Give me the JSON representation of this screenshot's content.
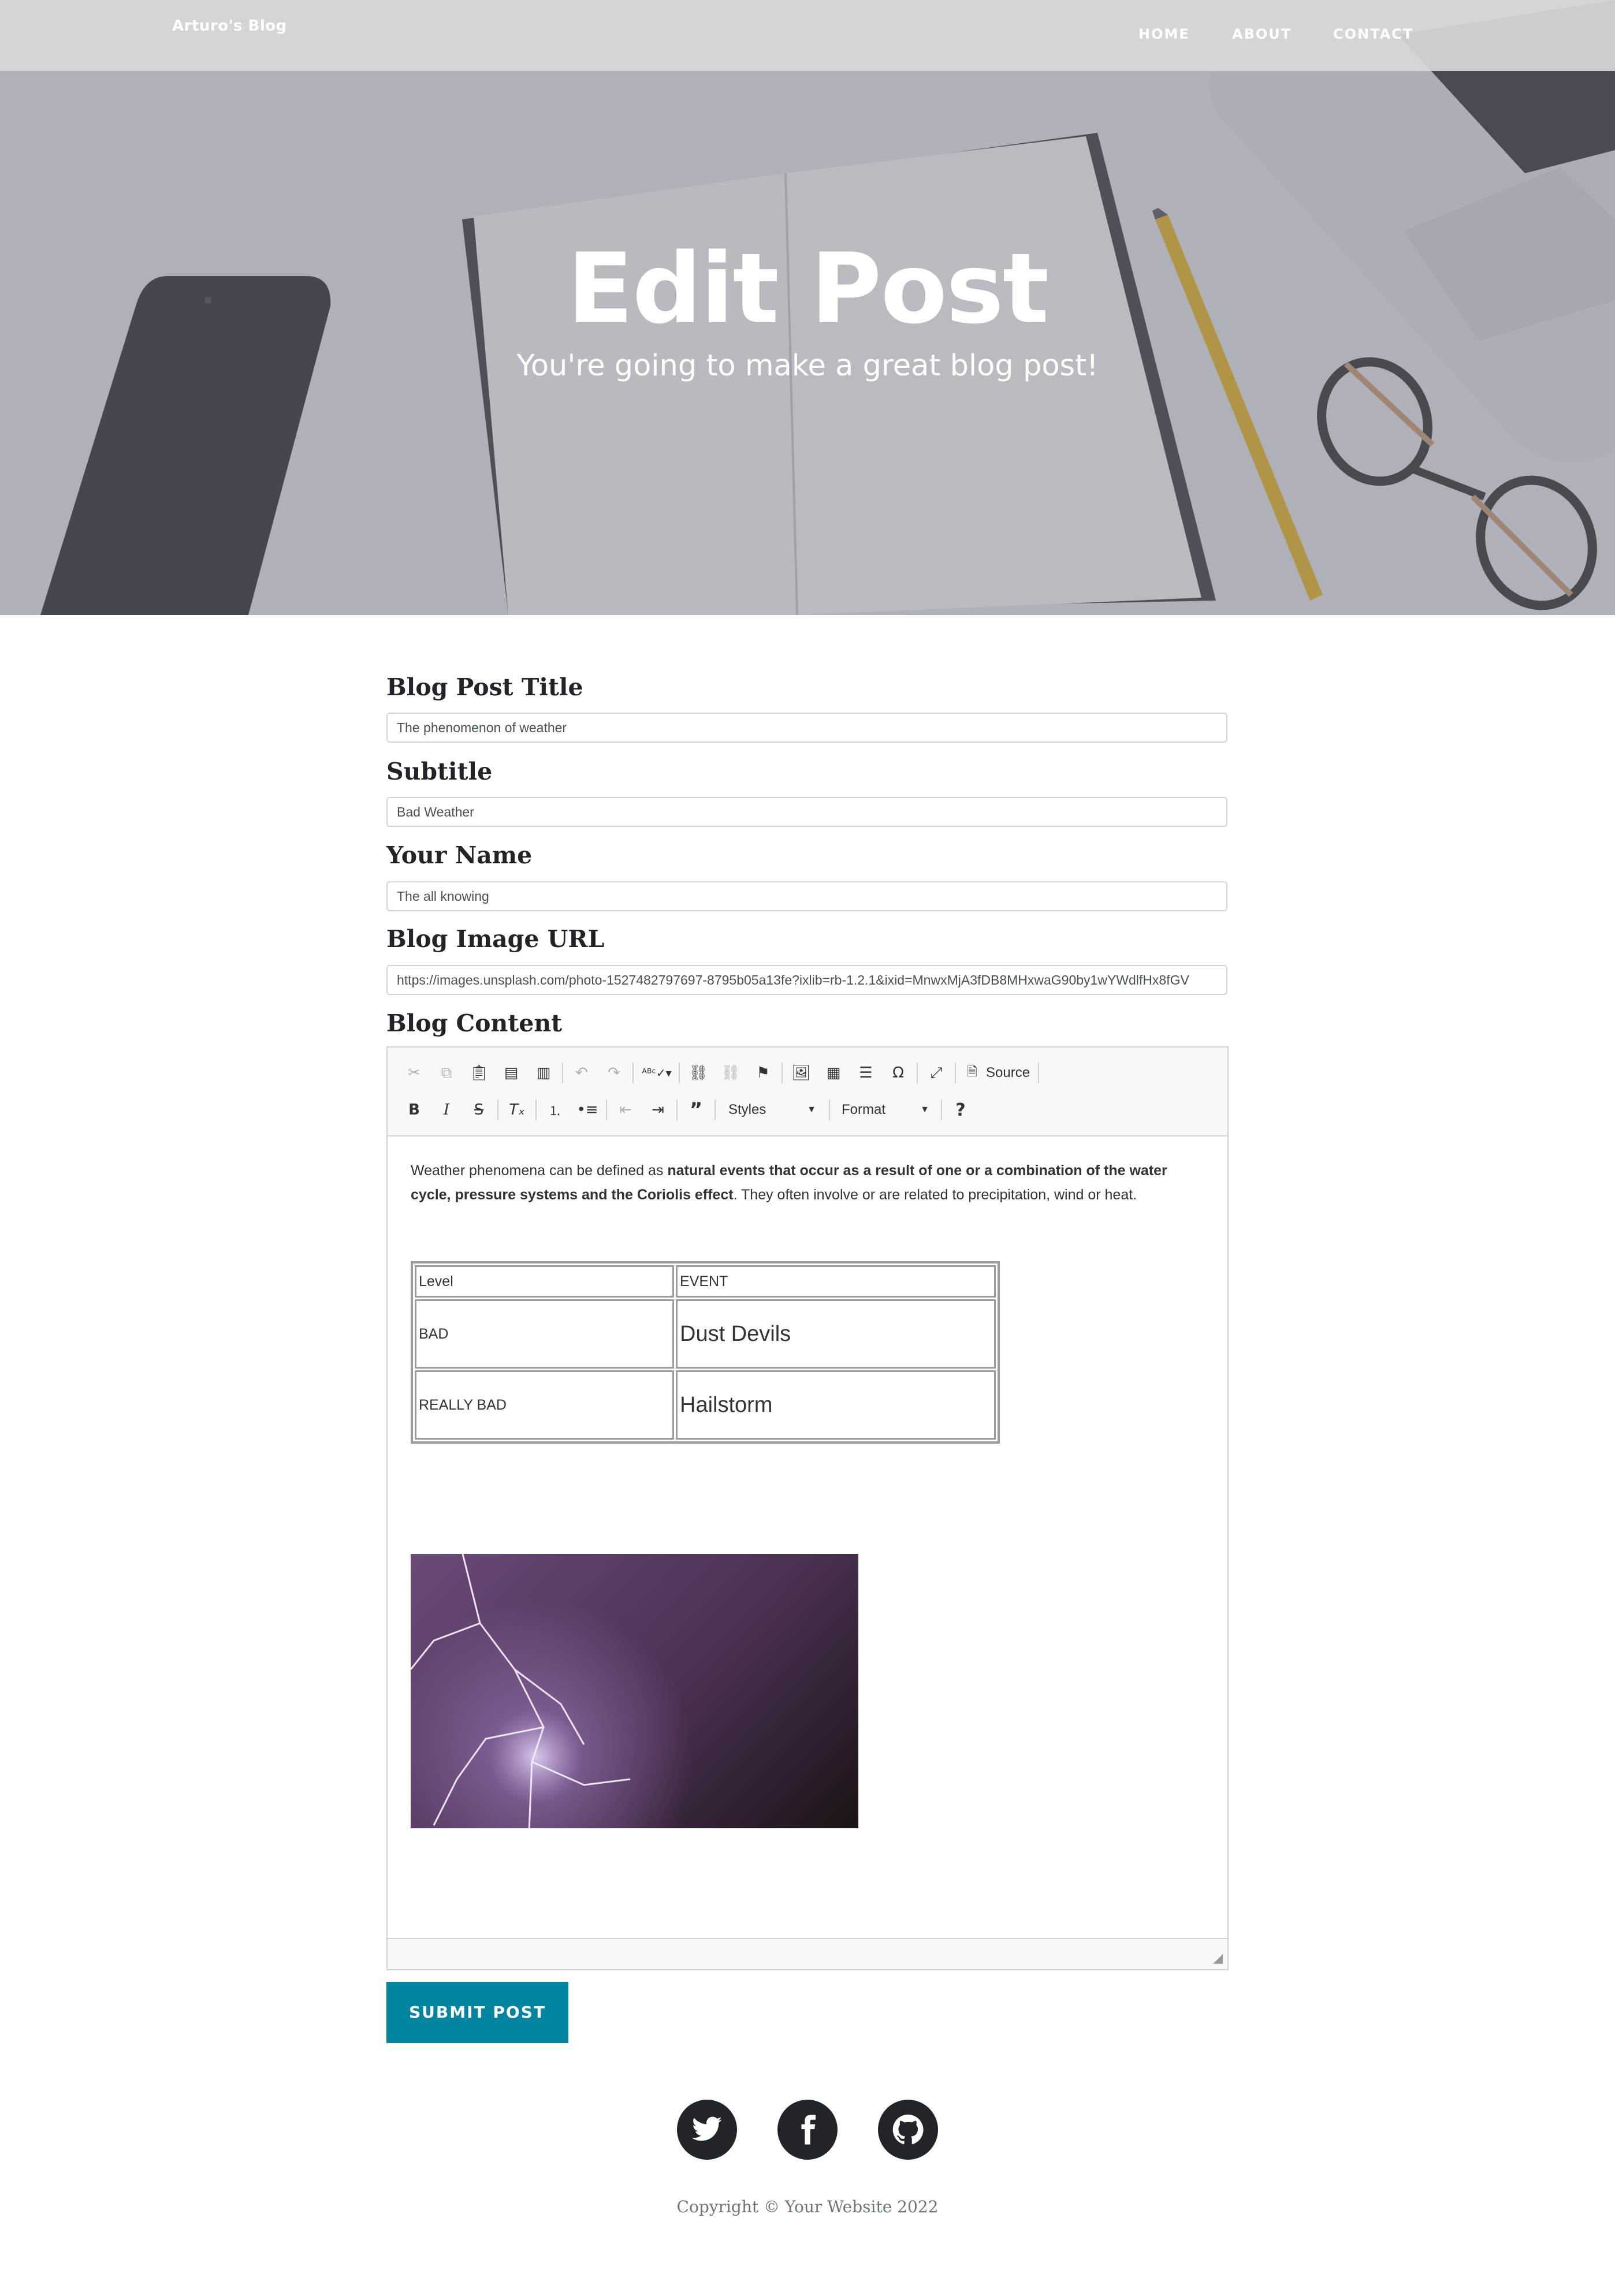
{
  "nav": {
    "brand": "Arturo's Blog",
    "links": [
      "HOME",
      "ABOUT",
      "CONTACT"
    ]
  },
  "masthead": {
    "title": "Edit Post",
    "subtitle": "You're going to make a great blog post!"
  },
  "form": {
    "title_label": "Blog Post Title",
    "title_value": "The phenomenon of weather",
    "subtitle_label": "Subtitle",
    "subtitle_value": "Bad Weather",
    "name_label": "Your Name",
    "name_value": "The all knowing",
    "image_label": "Blog Image URL",
    "image_value": "https://images.unsplash.com/photo-1527482797697-8795b05a13fe?ixlib=rb-1.2.1&ixid=MnwxMjA3fDB8MHxwaG90by1wYWdlfHx8fGV",
    "content_label": "Blog Content",
    "submit_label": "SUBMIT POST"
  },
  "editor": {
    "toolbar": {
      "source_label": "Source",
      "styles_label": "Styles",
      "format_label": "Format",
      "icons_row1": [
        "cut-icon",
        "copy-icon",
        "paste-icon",
        "paste-text-icon",
        "paste-word-icon",
        "paste-from-word-icon",
        "undo-icon",
        "redo-icon",
        "spellcheck-icon",
        "link-icon",
        "unlink-icon",
        "anchor-flag-icon",
        "image-icon",
        "table-icon",
        "horizontal-line-icon",
        "special-char-icon",
        "maximize-icon",
        "source-icon"
      ],
      "icons_row2": [
        "bold-icon",
        "italic-icon",
        "strikethrough-icon",
        "remove-format-icon",
        "numbered-list-icon",
        "bulleted-list-icon",
        "outdent-icon",
        "indent-icon",
        "blockquote-icon",
        "help-icon"
      ]
    },
    "paragraph": {
      "intro": "Weather phenomena can be defined as ",
      "bold": "natural events that occur as a result of one or a combination of the water cycle, pressure systems and the Coriolis effect",
      "outro": ". They often involve or are related to precipitation, wind or heat."
    },
    "table": {
      "headers": [
        "Level",
        "EVENT"
      ],
      "rows": [
        [
          "BAD",
          "Dust Devils"
        ],
        [
          "REALLY BAD",
          "Hailstorm"
        ]
      ]
    }
  },
  "footer": {
    "social_icons": [
      "twitter-icon",
      "facebook-icon",
      "github-icon"
    ],
    "copyright": "Copyright © Your Website 2022"
  },
  "colors": {
    "accent": "#0085a1",
    "dark": "#212529",
    "muted": "#6c757d"
  }
}
